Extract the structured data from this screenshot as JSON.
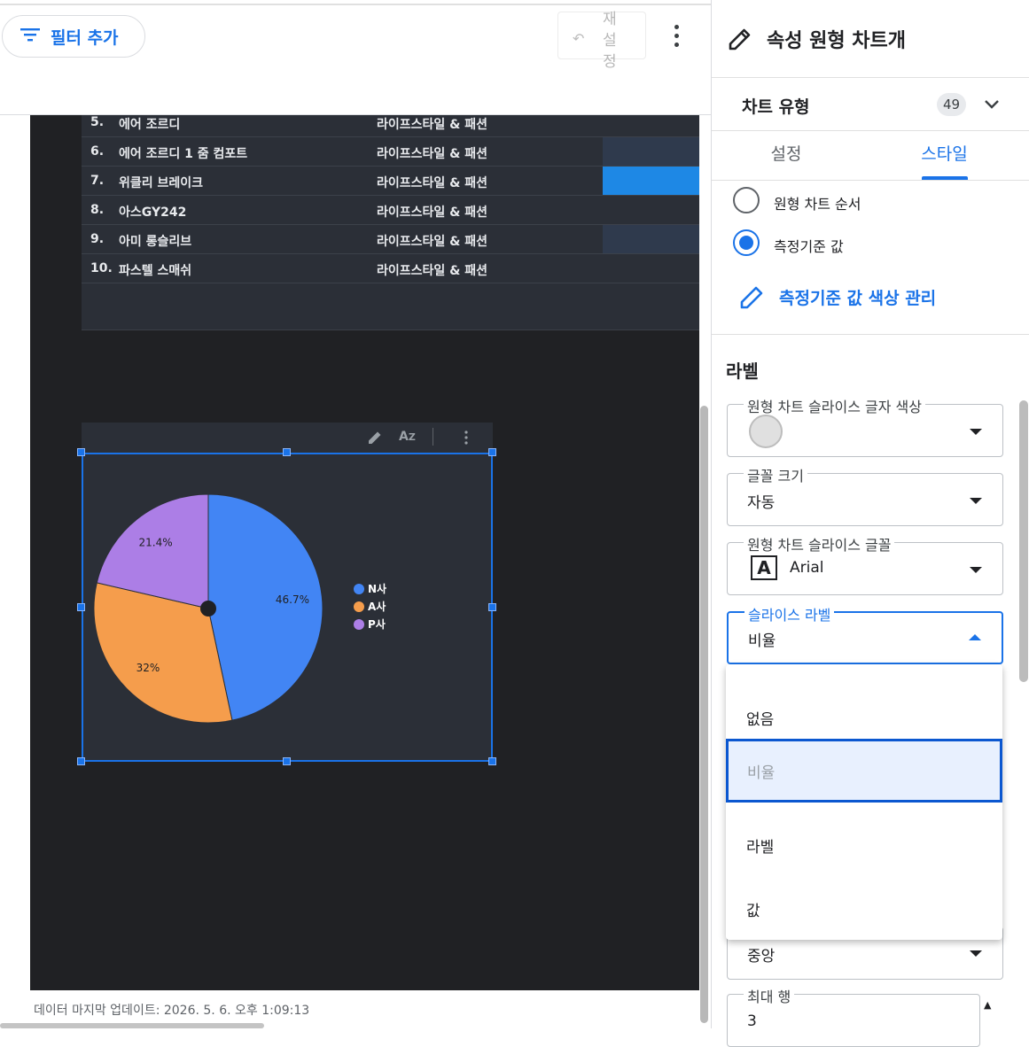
{
  "toolbar": {
    "filter_label": "필터 추가",
    "filter_icon": "filter-list-icon",
    "reset_label": "재설정",
    "reset_icon": "undo-icon",
    "more_icon": "more-vert-icon"
  },
  "table": {
    "rows": [
      {
        "num": "5.",
        "name": "에어 조르디",
        "category": "라이프스타일 & 패션",
        "bar_intensity": "none"
      },
      {
        "num": "6.",
        "name": "에어 조르디 1 줌 컴포트",
        "category": "라이프스타일 & 패션",
        "bar_intensity": "dark"
      },
      {
        "num": "7.",
        "name": "위클리 브레이크",
        "category": "라이프스타일 & 패션",
        "bar_intensity": "bright"
      },
      {
        "num": "8.",
        "name": "아스GY242",
        "category": "라이프스타일 & 패션",
        "bar_intensity": "none"
      },
      {
        "num": "9.",
        "name": "아미 롱슬리브",
        "category": "라이프스타일 & 패션",
        "bar_intensity": "dark"
      },
      {
        "num": "10.",
        "name": "파스텔 스매쉬",
        "category": "라이프스타일 & 패션",
        "bar_intensity": "none"
      }
    ]
  },
  "chart_tools": {
    "edit_icon": "pencil-icon",
    "sort_icon": "sort-az-icon",
    "more_icon": "more-vert-icon"
  },
  "chart_data": {
    "type": "pie",
    "slices": [
      {
        "name": "N사",
        "value": 46.7,
        "label": "46.7%",
        "color": "#4285f4"
      },
      {
        "name": "A사",
        "value": 32,
        "label": "32%",
        "color": "#f59d4c"
      },
      {
        "name": "P사",
        "value": 21.4,
        "label": "21.4%",
        "color": "#ac7ee6"
      }
    ],
    "legend_position": "right",
    "title": ""
  },
  "footer": {
    "last_updated": "데이터 마지막 업데이트: 2026. 5. 6. 오후 1:09:13"
  },
  "panel": {
    "title": "속성 원형 차트개",
    "title_icon": "pencil-icon",
    "chart_type_label": "차트 유형",
    "chart_type_badge": "49",
    "tabs": [
      "설정",
      "스타일"
    ],
    "active_tab": "스타일",
    "radio_options": [
      {
        "label": "원형 차트 순서",
        "selected": false
      },
      {
        "label": "측정기준 값",
        "selected": true
      }
    ],
    "manage_colors_label": "측정기준 값 색상 관리",
    "section_title": "라벨",
    "fields": {
      "slice_text_color": {
        "legend": "원형 차트 슬라이스 글자 색상",
        "swatch_color": "#e0e0e0"
      },
      "font_size": {
        "legend": "글꼴 크기",
        "value": "자동"
      },
      "slice_font": {
        "legend": "원형 차트 슬라이스 글꼴",
        "value": "Arial",
        "icon": "font-a-icon"
      },
      "slice_label": {
        "legend": "슬라이스 라벨",
        "value": "비율"
      },
      "alignment": {
        "value": "중앙"
      },
      "max_rows": {
        "legend": "최대 행",
        "value": "3"
      }
    },
    "slice_label_menu": {
      "options": [
        "없음",
        "비율",
        "라벨",
        "값"
      ],
      "selected": "비율"
    }
  },
  "colors": {
    "accent": "#1a73e8",
    "canvas_bg": "#202124",
    "card_bg": "#2b2f37"
  }
}
